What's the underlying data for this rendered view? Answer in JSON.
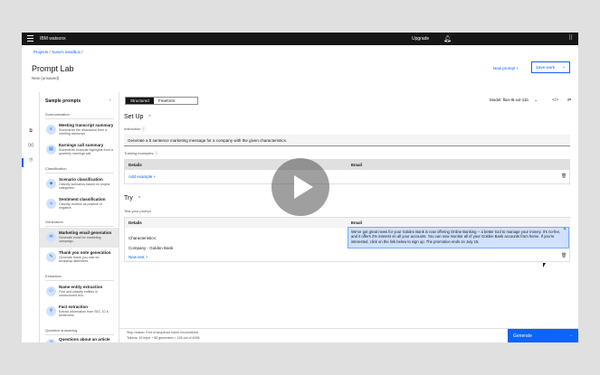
{
  "topbar": {
    "brand": "IBM watsonx",
    "upgrade": "Upgrade"
  },
  "breadcrumb": {
    "projects": "Projects",
    "sep1": "/",
    "sandbox": "Suna's sandbox",
    "sep2": "/"
  },
  "page": {
    "title": "Prompt Lab",
    "subtitle": "New (unsaved)",
    "new_prompt": "New prompt +",
    "save_work": "Save work",
    "save_chevron": "⌄"
  },
  "sidebar": {
    "heading": "Sample prompts",
    "collapse": "‹",
    "sections": {
      "summarization": "Summarization",
      "classification": "Classification",
      "generation": "Generation",
      "extraction": "Extraction",
      "question": "Question answering"
    },
    "items": [
      {
        "title": "Meeting transcript summary",
        "desc": "Summarize the discussion from a meeting transcript."
      },
      {
        "title": "Earnings call summary",
        "desc": "Summarize financial highlights from a quarterly earnings call."
      },
      {
        "title": "Scenario classification",
        "desc": "Classify scenarios based on project categories."
      },
      {
        "title": "Sentiment classification",
        "desc": "Classify reviews as positive or negative."
      },
      {
        "title": "Marketing email generation",
        "desc": "Generate email for marketing campaign."
      },
      {
        "title": "Thank you note generation",
        "desc": "Generate thank you note for workshop attendees."
      },
      {
        "title": "Name entity extraction",
        "desc": "Find and classify entities in unstructured text."
      },
      {
        "title": "Fact extraction",
        "desc": "Extract information from SEC 10-K sentences."
      },
      {
        "title": "Questions about an article",
        "desc": ""
      }
    ]
  },
  "main": {
    "tab_structured": "Structured",
    "tab_freeform": "Freeform",
    "model_label": "Model: flan-t5-xxl-11b",
    "model_chevron": "⌄",
    "setup_heading": "Set Up",
    "instruction_label": "Instruction",
    "instruction_value": "Generate a 5 sentence marketing message for a company with the given characteristics.",
    "training_label": "Training examples",
    "col_details": "Details",
    "col_email": "Email",
    "add_example": "Add example +",
    "try_heading": "Try",
    "test_label": "Test your prompt",
    "try_col_details": "Details",
    "try_col_email": "Email",
    "row_characteristics": "Characteristics:",
    "row_company": "Company - Golden Bank",
    "output_text": "We've got great news for your Golden Bank is now offering Online Banking -- a better tool to manage your money. It's no-fee, and it offers 2% interest on all your accounts. You can now monitor all of your Golden Bank accounts from home. If you're interested, click on the link below to sign up. The promotion ends on July 15.",
    "new_test": "New test +"
  },
  "footer": {
    "stop_reason": "Stop reason: End of sequence token encountered",
    "tokens": "Tokens: 43 input + 85 generated = 128 out of 4096",
    "generate": "Generate",
    "generate_arrow": "→"
  },
  "colors": {
    "primary": "#0f62fe",
    "topbar": "#161616",
    "highlight": "#d0e2ff"
  }
}
